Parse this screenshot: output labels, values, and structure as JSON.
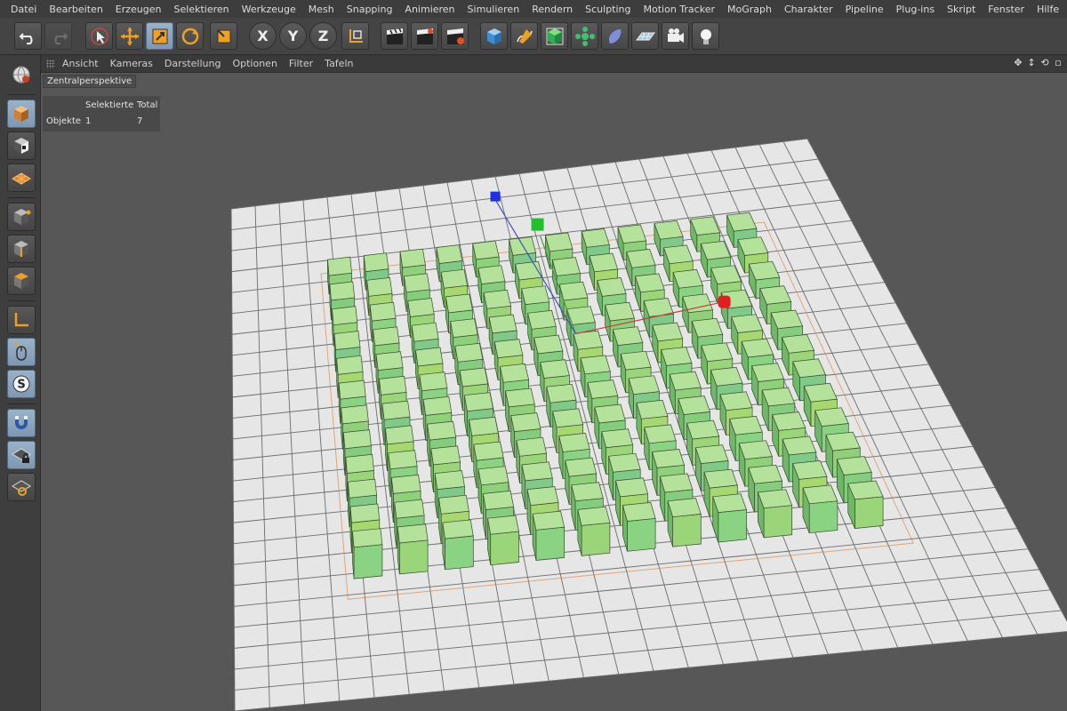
{
  "menu": [
    "Datei",
    "Bearbeiten",
    "Erzeugen",
    "Selektieren",
    "Werkzeuge",
    "Mesh",
    "Snapping",
    "Animieren",
    "Simulieren",
    "Rendern",
    "Sculpting",
    "Motion Tracker",
    "MoGraph",
    "Charakter",
    "Pipeline",
    "Plug-ins",
    "Skript",
    "Fenster",
    "Hilfe"
  ],
  "toolbar": {
    "axis_x": "X",
    "axis_y": "Y",
    "axis_z": "Z"
  },
  "viewport_menu": [
    "Ansicht",
    "Kameras",
    "Darstellung",
    "Optionen",
    "Filter",
    "Tafeln"
  ],
  "viewport": {
    "camera": "Zentralperspektive"
  },
  "hud": {
    "col_selected": "Selektierte",
    "col_total": "Total",
    "row_label": "Objekte",
    "selected_value": "1",
    "total_value": "7"
  },
  "colors": {
    "accent_blue": "#8aa3bc",
    "cube_green": "#8fd07a",
    "floor": "#e6e6e6",
    "selection_outline": "#e07a30"
  },
  "scene": {
    "floor_cells": 24,
    "cube_columns": 12,
    "cube_rows": 12
  }
}
